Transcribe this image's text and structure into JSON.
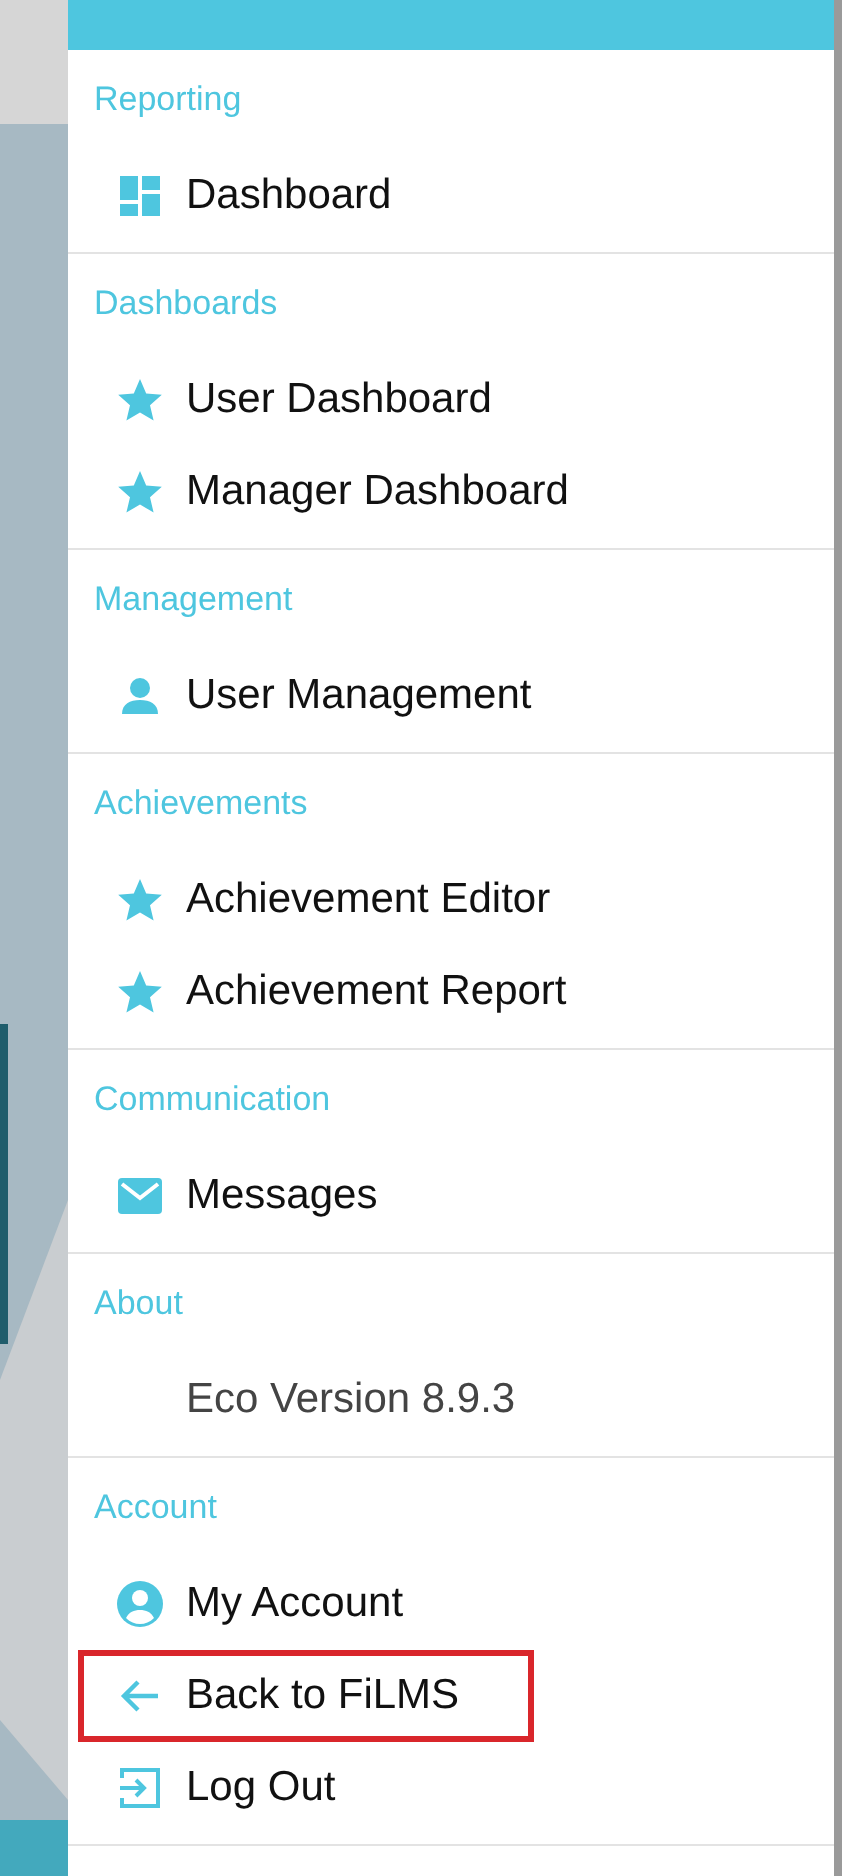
{
  "sections": [
    {
      "title": "Reporting",
      "items": [
        {
          "kind": "grid",
          "label": "Dashboard",
          "highlighted": false
        }
      ]
    },
    {
      "title": "Dashboards",
      "items": [
        {
          "kind": "star",
          "label": "User Dashboard",
          "highlighted": false
        },
        {
          "kind": "star",
          "label": "Manager Dashboard",
          "highlighted": false
        }
      ]
    },
    {
      "title": "Management",
      "items": [
        {
          "kind": "person",
          "label": "User Management",
          "highlighted": false
        }
      ]
    },
    {
      "title": "Achievements",
      "items": [
        {
          "kind": "star",
          "label": "Achievement Editor",
          "highlighted": false
        },
        {
          "kind": "star",
          "label": "Achievement Report",
          "highlighted": false
        }
      ]
    },
    {
      "title": "Communication",
      "items": [
        {
          "kind": "mail",
          "label": "Messages",
          "highlighted": false
        }
      ]
    },
    {
      "title": "About",
      "items": [
        {
          "kind": "text",
          "label": "Eco Version 8.9.3",
          "highlighted": false
        }
      ]
    },
    {
      "title": "Account",
      "items": [
        {
          "kind": "account",
          "label": "My Account",
          "highlighted": false
        },
        {
          "kind": "back",
          "label": "Back to FiLMS",
          "highlighted": true
        },
        {
          "kind": "logout",
          "label": "Log Out",
          "highlighted": false
        }
      ]
    }
  ]
}
